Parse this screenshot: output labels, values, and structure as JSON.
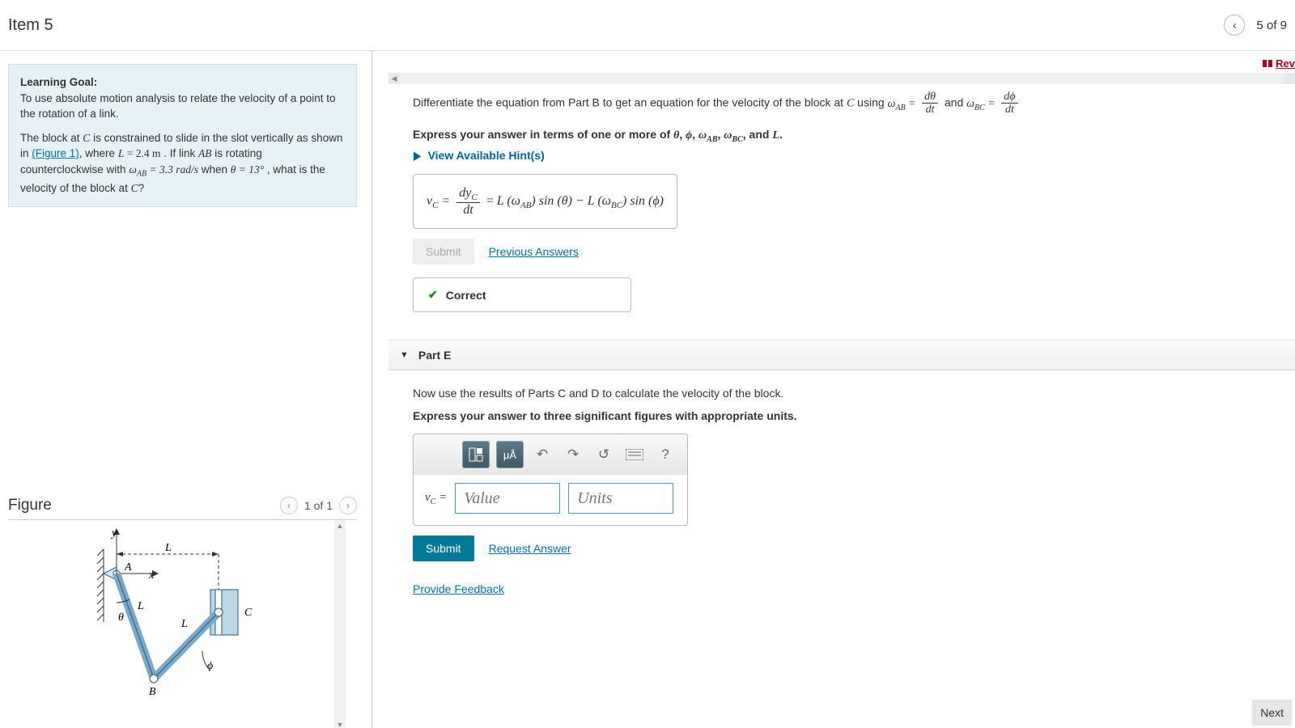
{
  "header": {
    "title": "Item 5",
    "progress": "5 of 9"
  },
  "review_label": "Rev",
  "goal": {
    "heading": "Learning Goal:",
    "p1": "To use absolute motion analysis to relate the velocity of a point to the rotation of a link.",
    "p2a": "The block at ",
    "p2b": " is constrained to slide in the slot vertically as shown in ",
    "fig_link": "(Figure 1)",
    "p2c": ", where ",
    "Lval": "L = 2.4 m",
    "p2d": " . If link ",
    "p2e": " is rotating counterclockwise with ",
    "wval": "ω_AB = 3.3 rad/s",
    "p2f": " when ",
    "thval": "θ = 13°",
    "p2g": " , what is the velocity of the block at ",
    "p2h": "?"
  },
  "figure": {
    "title": "Figure",
    "counter": "1 of 1"
  },
  "partD": {
    "q1a": "Differentiate the equation from Part B to get an equation for the velocity of the block at ",
    "q1b": " using ",
    "q1c": " and ",
    "instr": "Express your answer in terms of one or more of θ, ϕ, ω_AB, ω_BC, and L.",
    "hints": "View Available Hint(s)",
    "answer_plain": "v_C = dy_C/dt = L(ω_AB) sin(θ) − L(ω_BC) sin(ϕ)",
    "submit": "Submit",
    "prev": "Previous Answers",
    "correct": "Correct"
  },
  "partE": {
    "title": "Part E",
    "q": "Now use the results of Parts C and D to calculate the velocity of the block.",
    "instr": "Express your answer to three significant figures with appropriate units.",
    "toolbar_mu": "μÅ",
    "label": "v_C =",
    "value_ph": "Value",
    "units_ph": "Units",
    "submit": "Submit",
    "request": "Request Answer"
  },
  "feedback": "Provide Feedback",
  "next": "Next"
}
